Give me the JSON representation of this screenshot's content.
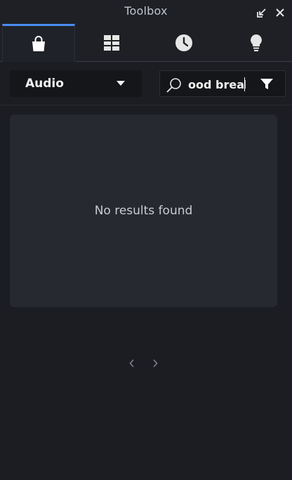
{
  "window": {
    "title": "Toolbox"
  },
  "titlebar_icons": {
    "dock": "dock-icon",
    "close": "close-icon"
  },
  "tabs": [
    {
      "icon": "shopping-bag-icon",
      "active": true
    },
    {
      "icon": "grid-icon",
      "active": false
    },
    {
      "icon": "clock-icon",
      "active": false
    },
    {
      "icon": "lightbulb-icon",
      "active": false
    }
  ],
  "category": {
    "selected": "Audio"
  },
  "search": {
    "value": "ood break",
    "icon": "search-icon",
    "filter_icon": "filter-icon"
  },
  "results": {
    "empty_message": "No results found"
  },
  "pager": {
    "prev_icon": "chevron-left-icon",
    "next_icon": "chevron-right-icon"
  },
  "colors": {
    "accent": "#4a8df0",
    "background": "#1b1d22",
    "panel": "#262930"
  }
}
